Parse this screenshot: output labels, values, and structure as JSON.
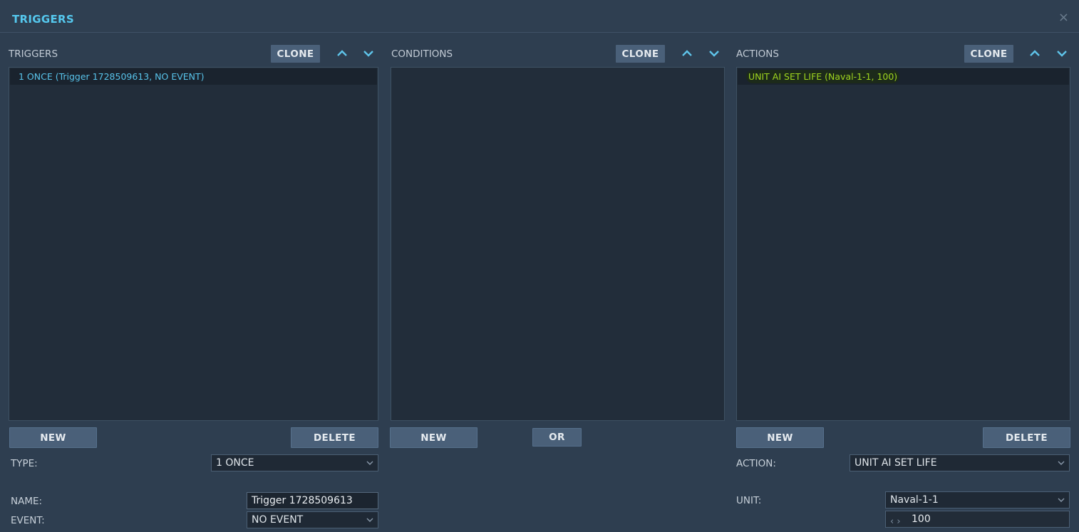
{
  "window": {
    "title": "TRIGGERS",
    "close": "×"
  },
  "triggers": {
    "label": "TRIGGERS",
    "clone_label": "CLONE",
    "items": [
      "1 ONCE (Trigger 1728509613, NO EVENT)"
    ],
    "new_label": "NEW",
    "delete_label": "DELETE",
    "type_label": "TYPE:",
    "type_value": "1 ONCE",
    "name_label": "NAME:",
    "name_value": "Trigger 1728509613",
    "event_label": "EVENT:",
    "event_value": "NO EVENT"
  },
  "conditions": {
    "label": "CONDITIONS",
    "clone_label": "CLONE",
    "new_label": "NEW",
    "or_label": "OR"
  },
  "actions": {
    "label": "ACTIONS",
    "clone_label": "CLONE",
    "items": [
      "UNIT AI SET LIFE (Naval-1-1, 100)"
    ],
    "new_label": "NEW",
    "delete_label": "DELETE",
    "action_label": "ACTION:",
    "action_value": "UNIT AI SET LIFE",
    "unit_label": "UNIT:",
    "unit_value": "Naval-1-1",
    "life_value": "100"
  },
  "colors": {
    "accent": "#55c8ee",
    "action_text": "#9fd61e",
    "background": "#2e3e50",
    "list_bg": "#222d3a",
    "button_bg": "#4a6079"
  },
  "icons": [
    "chevron-up-icon",
    "chevron-down-icon",
    "close-icon",
    "dropdown-chevron-icon"
  ]
}
